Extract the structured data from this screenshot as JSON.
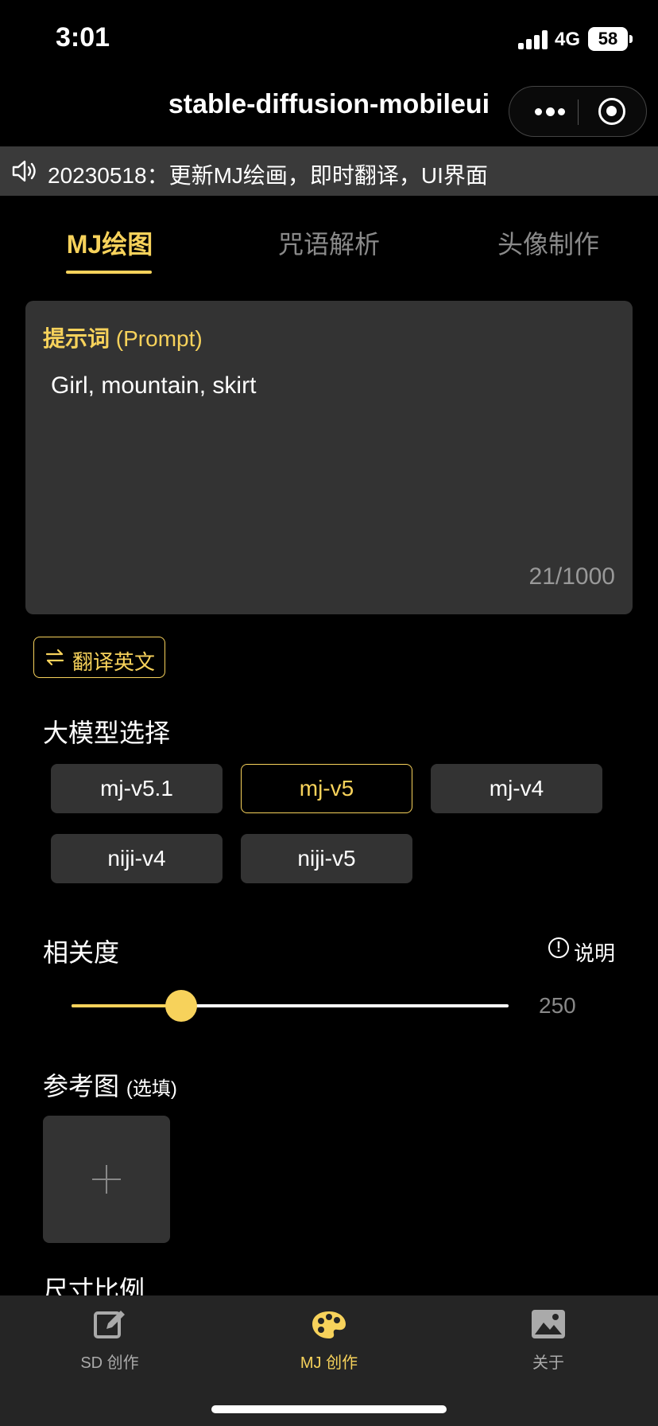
{
  "status_bar": {
    "time": "3:01",
    "network": "4G",
    "battery": "58"
  },
  "nav": {
    "title": "stable-diffusion-mobileui"
  },
  "notice": {
    "text": "20230518：更新MJ绘画，即时翻译，UI界面"
  },
  "tabs": [
    {
      "label": "MJ绘图",
      "active": true
    },
    {
      "label": "咒语解析",
      "active": false
    },
    {
      "label": "头像制作",
      "active": false
    }
  ],
  "prompt": {
    "label": "提示词",
    "label_hint": "(Prompt)",
    "value": "Girl, mountain, skirt",
    "count": "21/1000"
  },
  "translate_button": {
    "label": "翻译英文",
    "icon": "swap-icon"
  },
  "model_section": {
    "title": "大模型选择",
    "options": [
      {
        "label": "mj-v5.1",
        "selected": false
      },
      {
        "label": "mj-v5",
        "selected": true
      },
      {
        "label": "mj-v4",
        "selected": false
      },
      {
        "label": "niji-v4",
        "selected": false
      },
      {
        "label": "niji-v5",
        "selected": false
      }
    ]
  },
  "relevance": {
    "title": "相关度",
    "help_label": "说明",
    "help_icon": "!",
    "value": "250",
    "fraction": 0.25
  },
  "reference": {
    "title": "参考图",
    "optional": "(选填)",
    "add_icon": "plus-icon"
  },
  "size_section": {
    "title": "尺寸比例"
  },
  "tabbar": [
    {
      "label": "SD 创作",
      "icon": "edit-icon",
      "active": false
    },
    {
      "label": "MJ 创作",
      "icon": "palette-icon",
      "active": true
    },
    {
      "label": "关于",
      "icon": "image-icon",
      "active": false
    }
  ],
  "colors": {
    "accent": "#f7d25b",
    "card": "#333333",
    "background": "#000000",
    "tabbar": "#252525"
  }
}
